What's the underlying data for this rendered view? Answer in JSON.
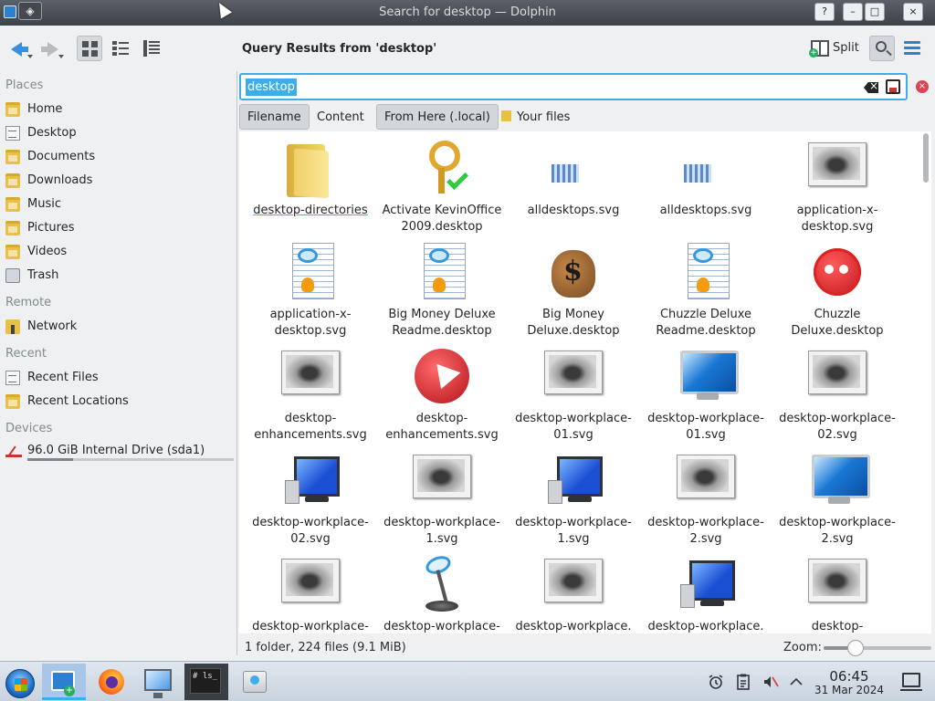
{
  "window": {
    "title": "Search for desktop — Dolphin",
    "controls": [
      "?",
      "–",
      "□",
      "×"
    ]
  },
  "toolbar": {
    "query_title": "Query Results from 'desktop'",
    "split_label": "Split",
    "icons": [
      "back-arrow-icon",
      "forward-arrow-icon",
      "icons-view-icon",
      "compact-view-icon",
      "details-view-icon",
      "split-icon",
      "search-icon",
      "hamburger-menu-icon"
    ]
  },
  "sidebar": {
    "places_label": "Places",
    "places": [
      {
        "label": "Home",
        "icon": "home-folder-icon"
      },
      {
        "label": "Desktop",
        "icon": "desktop-icon"
      },
      {
        "label": "Documents",
        "icon": "documents-folder-icon"
      },
      {
        "label": "Downloads",
        "icon": "downloads-folder-icon"
      },
      {
        "label": "Music",
        "icon": "music-folder-icon"
      },
      {
        "label": "Pictures",
        "icon": "pictures-folder-icon"
      },
      {
        "label": "Videos",
        "icon": "videos-folder-icon"
      },
      {
        "label": "Trash",
        "icon": "trash-icon"
      }
    ],
    "remote_label": "Remote",
    "remote": [
      {
        "label": "Network",
        "icon": "network-folder-icon"
      }
    ],
    "recent_label": "Recent",
    "recent": [
      {
        "label": "Recent Files",
        "icon": "recent-files-icon"
      },
      {
        "label": "Recent Locations",
        "icon": "recent-locations-icon"
      }
    ],
    "devices_label": "Devices",
    "devices": [
      {
        "label": "96.0 GiB Internal Drive (sda1)",
        "icon": "drive-icon",
        "usage_fraction": 0.22
      }
    ]
  },
  "search": {
    "value": "desktop",
    "filters": [
      "Filename",
      "Content",
      "From Here (.local)",
      "Your files"
    ],
    "active_filters": [
      "Filename",
      "From Here (.local)"
    ]
  },
  "results": {
    "items": [
      {
        "label": "desktop-directories",
        "icon": "folder"
      },
      {
        "label": "Activate KevinOffice 2009.desktop",
        "icon": "key"
      },
      {
        "label": "alldesktops.svg",
        "icon": "bars"
      },
      {
        "label": "alldesktops.svg",
        "icon": "bars"
      },
      {
        "label": "application-x-desktop.svg",
        "icon": "photo"
      },
      {
        "label": "application-x-desktop.svg",
        "icon": "readme"
      },
      {
        "label": "Big Money Deluxe Readme.desktop",
        "icon": "readme"
      },
      {
        "label": "Big Money Deluxe.desktop",
        "icon": "money"
      },
      {
        "label": "Chuzzle Deluxe Readme.desktop",
        "icon": "readme"
      },
      {
        "label": "Chuzzle Deluxe.desktop",
        "icon": "fluff"
      },
      {
        "label": "desktop-enhancements.svg",
        "icon": "photo"
      },
      {
        "label": "desktop-enhancements.svg",
        "icon": "cursor"
      },
      {
        "label": "desktop-workplace-01.svg",
        "icon": "photo"
      },
      {
        "label": "desktop-workplace-01.svg",
        "icon": "monitor"
      },
      {
        "label": "desktop-workplace-02.svg",
        "icon": "photo"
      },
      {
        "label": "desktop-workplace-02.svg",
        "icon": "monitor2"
      },
      {
        "label": "desktop-workplace-1.svg",
        "icon": "photo"
      },
      {
        "label": "desktop-workplace-1.svg",
        "icon": "monitor2"
      },
      {
        "label": "desktop-workplace-2.svg",
        "icon": "photo"
      },
      {
        "label": "desktop-workplace-2.svg",
        "icon": "monitor"
      },
      {
        "label": "desktop-workplace-",
        "icon": "photo"
      },
      {
        "label": "desktop-workplace-",
        "icon": "lamp"
      },
      {
        "label": "desktop-workplace.",
        "icon": "photo"
      },
      {
        "label": "desktop-workplace.",
        "icon": "monitor2"
      },
      {
        "label": "desktop-",
        "icon": "photo"
      }
    ]
  },
  "statusbar": {
    "summary": "1 folder, 224 files (9.1 MiB)",
    "zoom_label": "Zoom:",
    "zoom_fraction": 0.3
  },
  "taskbar": {
    "apps": [
      "start-menu-icon",
      "file-manager-icon",
      "firefox-icon",
      "system-settings-icon",
      "terminal-icon",
      "package-manager-icon"
    ],
    "terminal_text": "# ls_",
    "tray": [
      "alarm-icon",
      "clipboard-icon",
      "volume-muted-icon",
      "expand-tray-icon"
    ],
    "clock_time": "06:45",
    "clock_date": "31 Mar 2024"
  },
  "colors": {
    "accent": "#3daee9",
    "selection_text": "#ffffff",
    "close_red": "#da4453"
  }
}
